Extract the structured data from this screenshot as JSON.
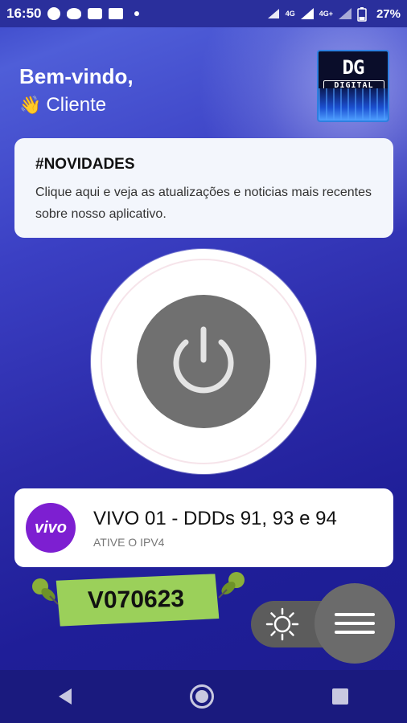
{
  "status_bar": {
    "time": "16:50",
    "network_1": "4G",
    "network_2": "4G+",
    "battery": "27%",
    "icons": [
      "whatsapp-icon",
      "mask-icon",
      "youtube-icon",
      "news-icon",
      "dot-icon",
      "sync-icon",
      "signal-icon",
      "signal-icon",
      "battery-icon"
    ]
  },
  "header": {
    "title": "Bem-vindo,",
    "wave_emoji": "👋",
    "user": "Cliente"
  },
  "logo": {
    "line1": "DG",
    "line2": "DIGITAL"
  },
  "news": {
    "title": "#NOVIDADES",
    "text": "Clique aqui e veja as atualizações e noticias mais recentes sobre nosso aplicativo."
  },
  "power": {
    "icon": "power-icon"
  },
  "server": {
    "logo_text": "vivo",
    "name": "VIVO 01 - DDDs 91, 93 e 94",
    "subtitle": "ATIVE O IPV4"
  },
  "version": {
    "code": "V070623"
  },
  "controls": {
    "theme_icon": "sun-icon",
    "menu_icon": "hamburger-icon"
  },
  "colors": {
    "background": "#2b2aa8",
    "card": "#f3f6fc",
    "power_button": "#707070",
    "vivo_purple": "#7d1fd1",
    "tape_green": "#9bd05a"
  }
}
